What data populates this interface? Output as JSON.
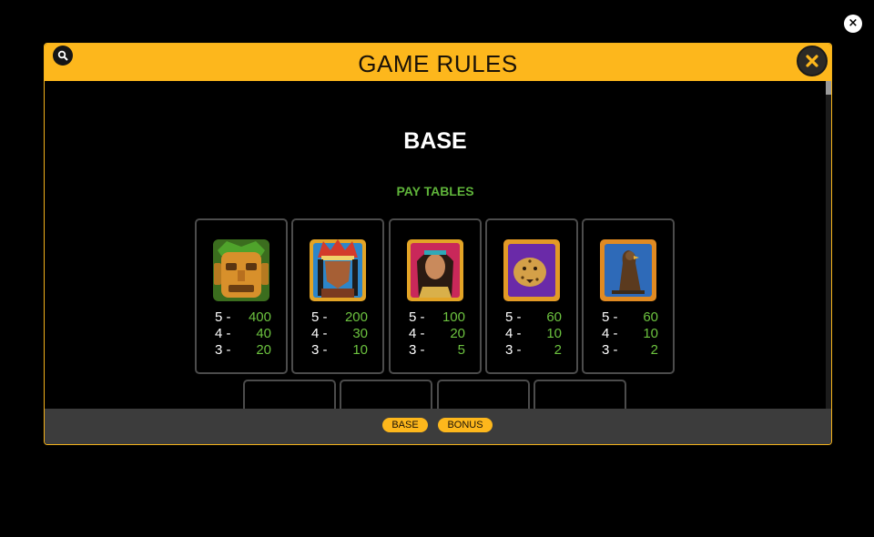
{
  "title": "GAME RULES",
  "section_heading": "BASE",
  "subheading": "PAY TABLES",
  "pay_table": [
    {
      "symbol": "jaguar-mask-icon",
      "rows": [
        {
          "count": "5 -",
          "value": "400"
        },
        {
          "count": "4 -",
          "value": "40"
        },
        {
          "count": "3 -",
          "value": "20"
        }
      ]
    },
    {
      "symbol": "chief-icon",
      "rows": [
        {
          "count": "5 -",
          "value": "200"
        },
        {
          "count": "4 -",
          "value": "30"
        },
        {
          "count": "3 -",
          "value": "10"
        }
      ]
    },
    {
      "symbol": "woman-icon",
      "rows": [
        {
          "count": "5 -",
          "value": "100"
        },
        {
          "count": "4 -",
          "value": "20"
        },
        {
          "count": "3 -",
          "value": "5"
        }
      ]
    },
    {
      "symbol": "leopard-icon",
      "rows": [
        {
          "count": "5 -",
          "value": "60"
        },
        {
          "count": "4 -",
          "value": "10"
        },
        {
          "count": "3 -",
          "value": "2"
        }
      ]
    },
    {
      "symbol": "eagle-icon",
      "rows": [
        {
          "count": "5 -",
          "value": "60"
        },
        {
          "count": "4 -",
          "value": "10"
        },
        {
          "count": "3 -",
          "value": "2"
        }
      ]
    }
  ],
  "tabs": [
    {
      "label": "BASE"
    },
    {
      "label": "BONUS"
    }
  ],
  "colors": {
    "accent": "#fdb71c",
    "value_green": "#6cc23f",
    "card_border": "#4c4c4c"
  }
}
